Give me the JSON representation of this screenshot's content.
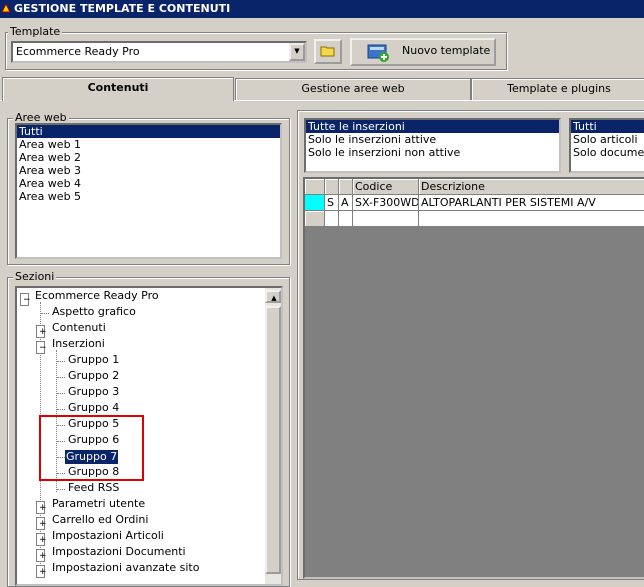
{
  "window": {
    "title": "GESTIONE TEMPLATE E CONTENUTI"
  },
  "template": {
    "legend": "Template",
    "selected": "Ecommerce Ready Pro",
    "new_button_label": "Nuovo template"
  },
  "tabs": [
    {
      "label": "Contenuti",
      "active": true
    },
    {
      "label": "Gestione aree web",
      "active": false
    },
    {
      "label": "Template e plugins",
      "active": false
    }
  ],
  "aree_web": {
    "legend": "Aree web",
    "items": [
      "Tutti",
      "Area web 1",
      "Area web 2",
      "Area web 3",
      "Area web 4",
      "Area web 5"
    ],
    "selected_index": 0
  },
  "sezioni": {
    "legend": "Sezioni",
    "root": "Ecommerce Ready Pro",
    "nodes": [
      "Aspetto grafico",
      "Contenuti",
      "Inserzioni",
      "Gruppo 1",
      "Gruppo 2",
      "Gruppo 3",
      "Gruppo 4",
      "Gruppo 5",
      "Gruppo 6",
      "Gruppo 7",
      "Gruppo 8",
      "Feed RSS",
      "Parametri utente",
      "Carrello ed Ordini",
      "Impostazioni Articoli",
      "Impostazioni Documenti",
      "Impostazioni avanzate sito"
    ],
    "selected": "Gruppo 7"
  },
  "filtro_inserzioni": {
    "items": [
      "Tutte le inserzioni",
      "Solo le inserzioni attive",
      "Solo le inserzioni non attive"
    ],
    "selected_index": 0
  },
  "filtro_tipo": {
    "items": [
      "Tutti",
      "Solo articoli",
      "Solo documenti"
    ],
    "selected_index": 0
  },
  "grid": {
    "columns": [
      "",
      "",
      "",
      "Codice",
      "Descrizione"
    ],
    "rows": [
      {
        "c1": "S",
        "c2": "A",
        "codice": "SX-F300WD",
        "descrizione": "ALTOPARLANTI PER SISTEMI A/V"
      }
    ]
  },
  "colors": {
    "selection": "#0a246a",
    "highlight_box": "#e00000",
    "row_marker": "#00ffff"
  }
}
